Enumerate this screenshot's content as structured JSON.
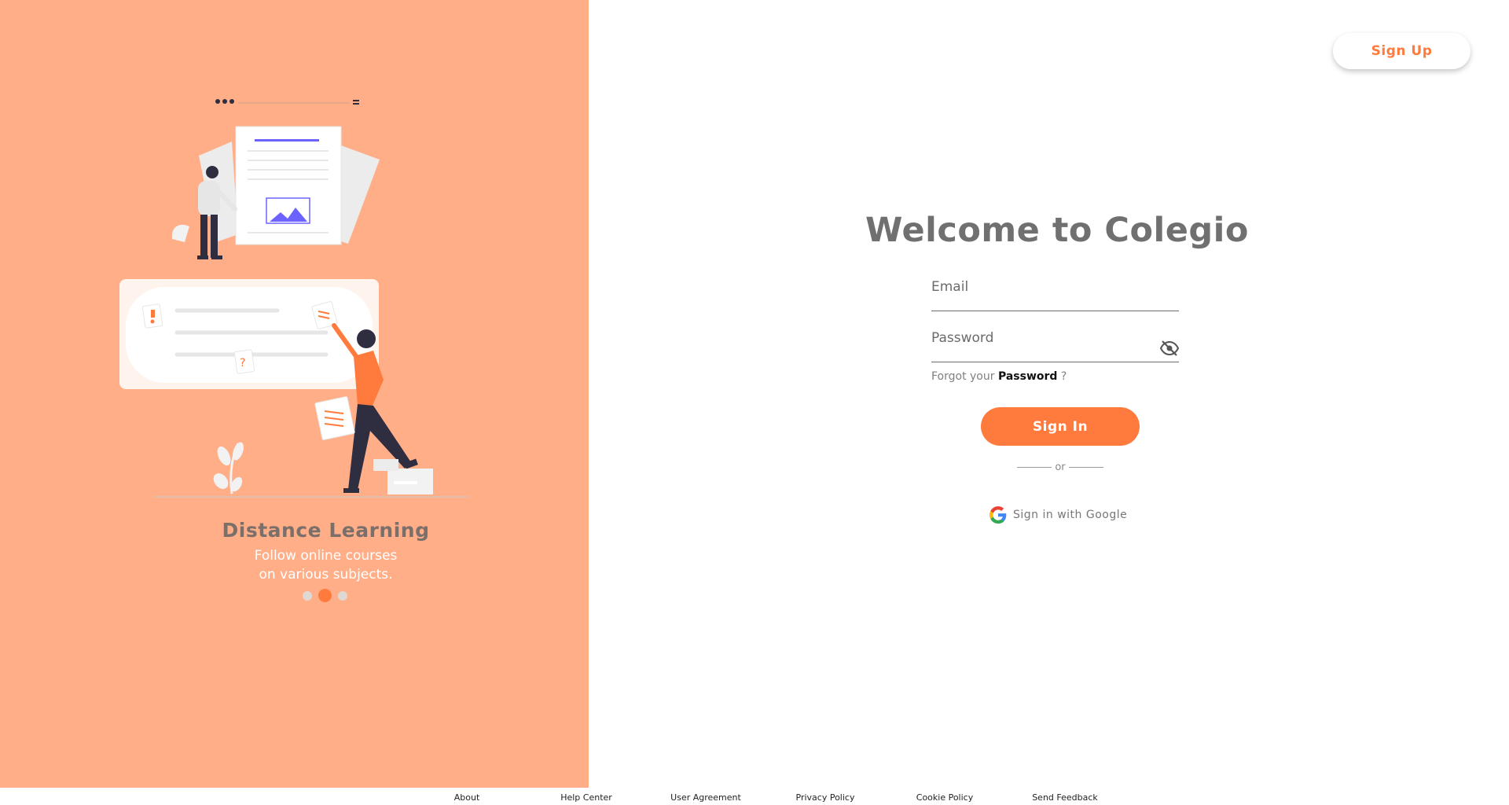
{
  "carousel": {
    "title": "Distance Learning",
    "subtitle_line1": "Follow online courses",
    "subtitle_line2": "on various subjects.",
    "slide_count": 3,
    "active_slide": 2
  },
  "header": {
    "signup_label": "Sign Up"
  },
  "login": {
    "welcome": "Welcome to Colegio",
    "email_placeholder": "Email",
    "password_placeholder": "Password",
    "forgot_prefix": "Forgot your",
    "forgot_link": "Password",
    "forgot_suffix": "?",
    "signin_label": "Sign In",
    "or_label": "or",
    "google_label": "Sign in with Google"
  },
  "footer": {
    "links": [
      "About",
      "Help Center",
      "User Agreement",
      "Privacy Policy",
      "Cookie Policy",
      "Send Feedback"
    ]
  },
  "colors": {
    "accent": "#ff7a3d",
    "panel": "#ffae87",
    "illustration_purple": "#6c63ff",
    "illustration_dark": "#2f2e41"
  },
  "icons": {
    "password_toggle": "eye-slash-icon",
    "google": "google-icon"
  }
}
